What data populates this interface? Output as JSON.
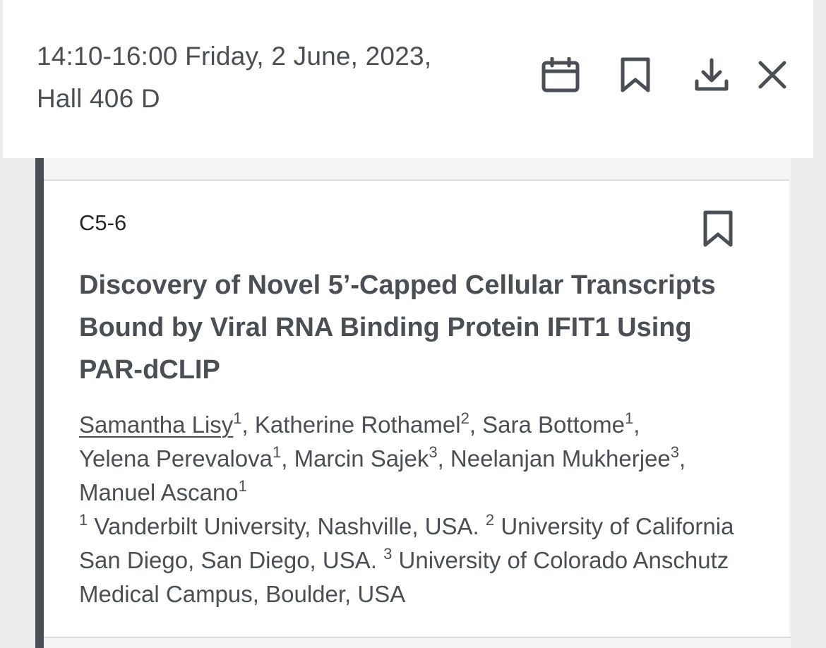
{
  "header": {
    "datetime": "14:10-16:00 Friday, 2 June, 2023,",
    "location": "Hall 406 D",
    "icons": [
      "calendar-icon",
      "bookmark-icon",
      "download-icon",
      "close-icon"
    ]
  },
  "abstract": {
    "code": "C5-6",
    "title_lines": [
      "Discovery of Novel 5’-Capped Cellular Transcripts",
      "Bound by Viral RNA Binding Protein IFIT1 Using",
      "PAR-dCLIP"
    ],
    "authors": [
      {
        "name": "Samantha Lisy",
        "sup": "1",
        "sep": ", "
      },
      {
        "name": "Katherine Rothamel",
        "sup": "2",
        "sep": ", "
      },
      {
        "name": "Sara Bottome",
        "sup": "1",
        "sep": ","
      },
      {
        "name": "Yelena Perevalova",
        "sup": "1",
        "sep": ", "
      },
      {
        "name": "Marcin Sajek",
        "sup": "3",
        "sep": ", "
      },
      {
        "name": "Neelanjan Mukherjee",
        "sup": "3",
        "sep": ","
      },
      {
        "name": "Manuel Ascano",
        "sup": "1",
        "sep": ""
      }
    ],
    "affiliations": [
      {
        "sup": "1",
        "text": "Vanderbilt University, Nashville, USA."
      },
      {
        "sup": "2",
        "text": "University of California San Diego, San Diego, USA."
      },
      {
        "sup": "3",
        "text": "University of Colorado Anschutz Medical Campus, Boulder, USA"
      }
    ]
  },
  "colors": {
    "text": "#4a4e55",
    "accent_strip": "#4a4e55",
    "background": "#ecedef",
    "card": "#ffffff"
  }
}
